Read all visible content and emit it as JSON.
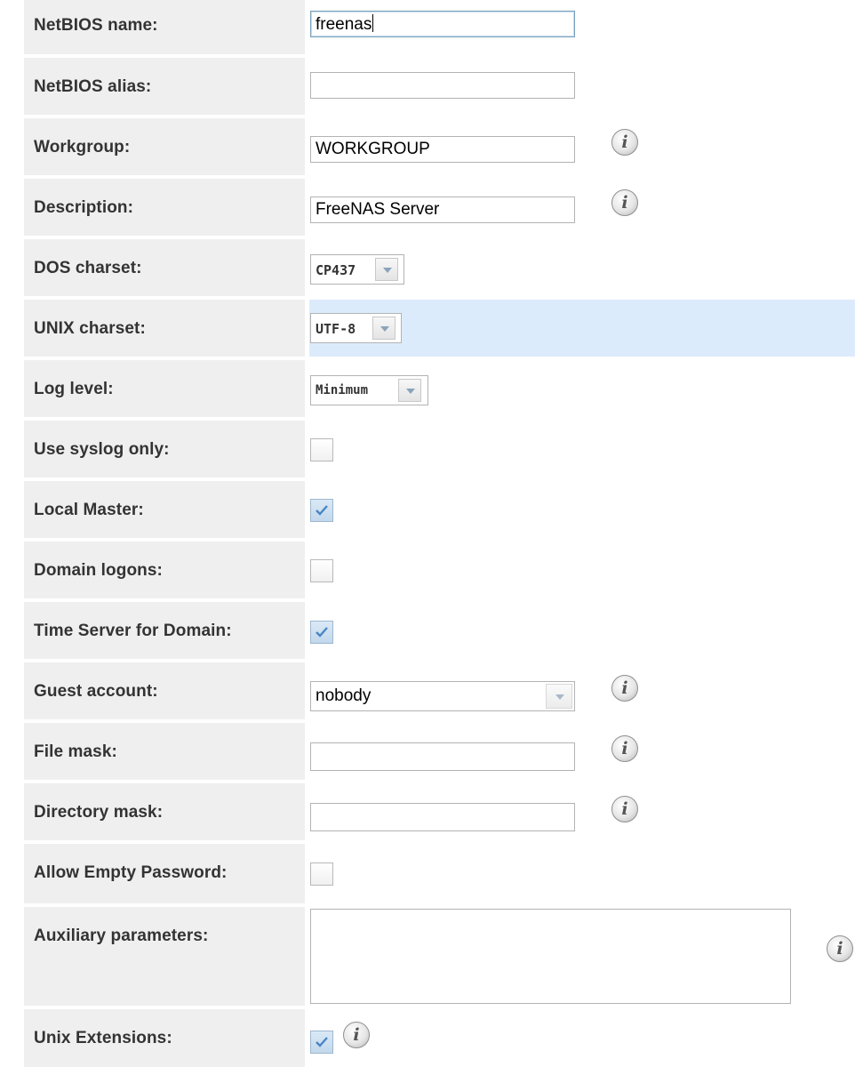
{
  "form": {
    "netbios_name": {
      "label": "NetBIOS name:",
      "value": "freenas"
    },
    "netbios_alias": {
      "label": "NetBIOS alias:",
      "value": ""
    },
    "workgroup": {
      "label": "Workgroup:",
      "value": "WORKGROUP"
    },
    "description": {
      "label": "Description:",
      "value": "FreeNAS Server"
    },
    "dos_charset": {
      "label": "DOS charset:",
      "value": "CP437"
    },
    "unix_charset": {
      "label": "UNIX charset:",
      "value": "UTF-8"
    },
    "log_level": {
      "label": "Log level:",
      "value": "Minimum"
    },
    "use_syslog_only": {
      "label": "Use syslog only:",
      "checked": false
    },
    "local_master": {
      "label": "Local Master:",
      "checked": true
    },
    "domain_logons": {
      "label": "Domain logons:",
      "checked": false
    },
    "time_server": {
      "label": "Time Server for Domain:",
      "checked": true
    },
    "guest_account": {
      "label": "Guest account:",
      "value": "nobody"
    },
    "file_mask": {
      "label": "File mask:",
      "value": ""
    },
    "directory_mask": {
      "label": "Directory mask:",
      "value": ""
    },
    "allow_empty_password": {
      "label": "Allow Empty Password:",
      "checked": false
    },
    "auxiliary_parameters": {
      "label": "Auxiliary parameters:",
      "value": ""
    },
    "unix_extensions": {
      "label": "Unix Extensions:",
      "checked": true
    }
  },
  "info_icon_glyph": "i",
  "colors": {
    "label_bg": "#efefef",
    "highlight_row": "#dcebfc",
    "label_text": "#333333"
  }
}
